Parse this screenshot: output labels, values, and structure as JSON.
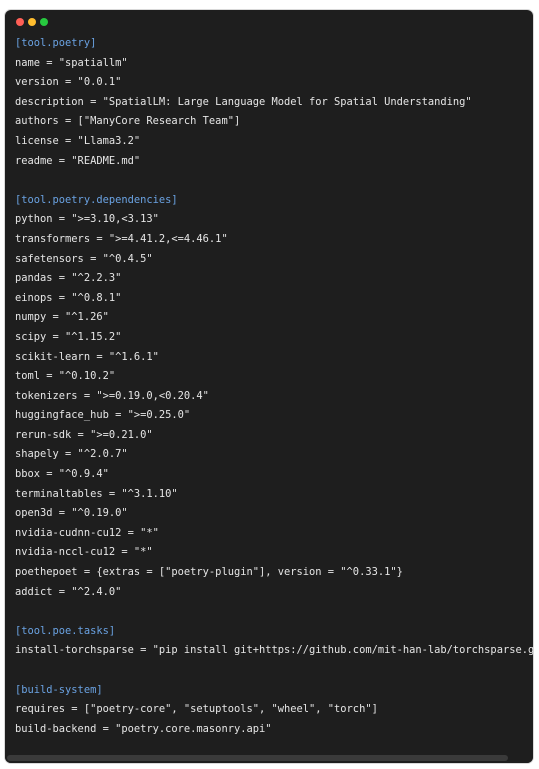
{
  "window": {
    "controls": [
      {
        "name": "close",
        "color": "#ff5f56"
      },
      {
        "name": "minimize",
        "color": "#ffbd2e"
      },
      {
        "name": "maximize",
        "color": "#27c93f"
      }
    ]
  },
  "code": {
    "lines": [
      {
        "text": "[tool.poetry]",
        "type": "section"
      },
      {
        "text": "name = \"spatiallm\"",
        "type": "kv"
      },
      {
        "text": "version = \"0.0.1\"",
        "type": "kv"
      },
      {
        "text": "description = \"SpatialLM: Large Language Model for Spatial Understanding\"",
        "type": "kv"
      },
      {
        "text": "authors = [\"ManyCore Research Team\"]",
        "type": "kv"
      },
      {
        "text": "license = \"Llama3.2\"",
        "type": "kv"
      },
      {
        "text": "readme = \"README.md\"",
        "type": "kv"
      },
      {
        "text": "",
        "type": "blank"
      },
      {
        "text": "[tool.poetry.dependencies]",
        "type": "section"
      },
      {
        "text": "python = \">=3.10,<3.13\"",
        "type": "kv"
      },
      {
        "text": "transformers = \">=4.41.2,<=4.46.1\"",
        "type": "kv"
      },
      {
        "text": "safetensors = \"^0.4.5\"",
        "type": "kv"
      },
      {
        "text": "pandas = \"^2.2.3\"",
        "type": "kv"
      },
      {
        "text": "einops = \"^0.8.1\"",
        "type": "kv"
      },
      {
        "text": "numpy = \"^1.26\"",
        "type": "kv"
      },
      {
        "text": "scipy = \"^1.15.2\"",
        "type": "kv"
      },
      {
        "text": "scikit-learn = \"^1.6.1\"",
        "type": "kv"
      },
      {
        "text": "toml = \"^0.10.2\"",
        "type": "kv"
      },
      {
        "text": "tokenizers = \">=0.19.0,<0.20.4\"",
        "type": "kv"
      },
      {
        "text": "huggingface_hub = \">=0.25.0\"",
        "type": "kv"
      },
      {
        "text": "rerun-sdk = \">=0.21.0\"",
        "type": "kv"
      },
      {
        "text": "shapely = \"^2.0.7\"",
        "type": "kv"
      },
      {
        "text": "bbox = \"^0.9.4\"",
        "type": "kv"
      },
      {
        "text": "terminaltables = \"^3.1.10\"",
        "type": "kv"
      },
      {
        "text": "open3d = \"^0.19.0\"",
        "type": "kv"
      },
      {
        "text": "nvidia-cudnn-cu12 = \"*\"",
        "type": "kv"
      },
      {
        "text": "nvidia-nccl-cu12 = \"*\"",
        "type": "kv"
      },
      {
        "text": "poethepoet = {extras = [\"poetry-plugin\"], version = \"^0.33.1\"}",
        "type": "kv"
      },
      {
        "text": "addict = \"^2.4.0\"",
        "type": "kv"
      },
      {
        "text": "",
        "type": "blank"
      },
      {
        "text": "[tool.poe.tasks]",
        "type": "section"
      },
      {
        "text": "install-torchsparse = \"pip install git+https://github.com/mit-han-lab/torchsparse.gi",
        "type": "kv"
      },
      {
        "text": "",
        "type": "blank"
      },
      {
        "text": "[build-system]",
        "type": "section"
      },
      {
        "text": "requires = [\"poetry-core\", \"setuptools\", \"wheel\", \"torch\"]",
        "type": "kv"
      },
      {
        "text": "build-backend = \"poetry.core.masonry.api\"",
        "type": "kv"
      }
    ]
  },
  "colors": {
    "background": "#1e1e1e",
    "text": "#e6e6e6",
    "section": "#6aa2e2"
  }
}
